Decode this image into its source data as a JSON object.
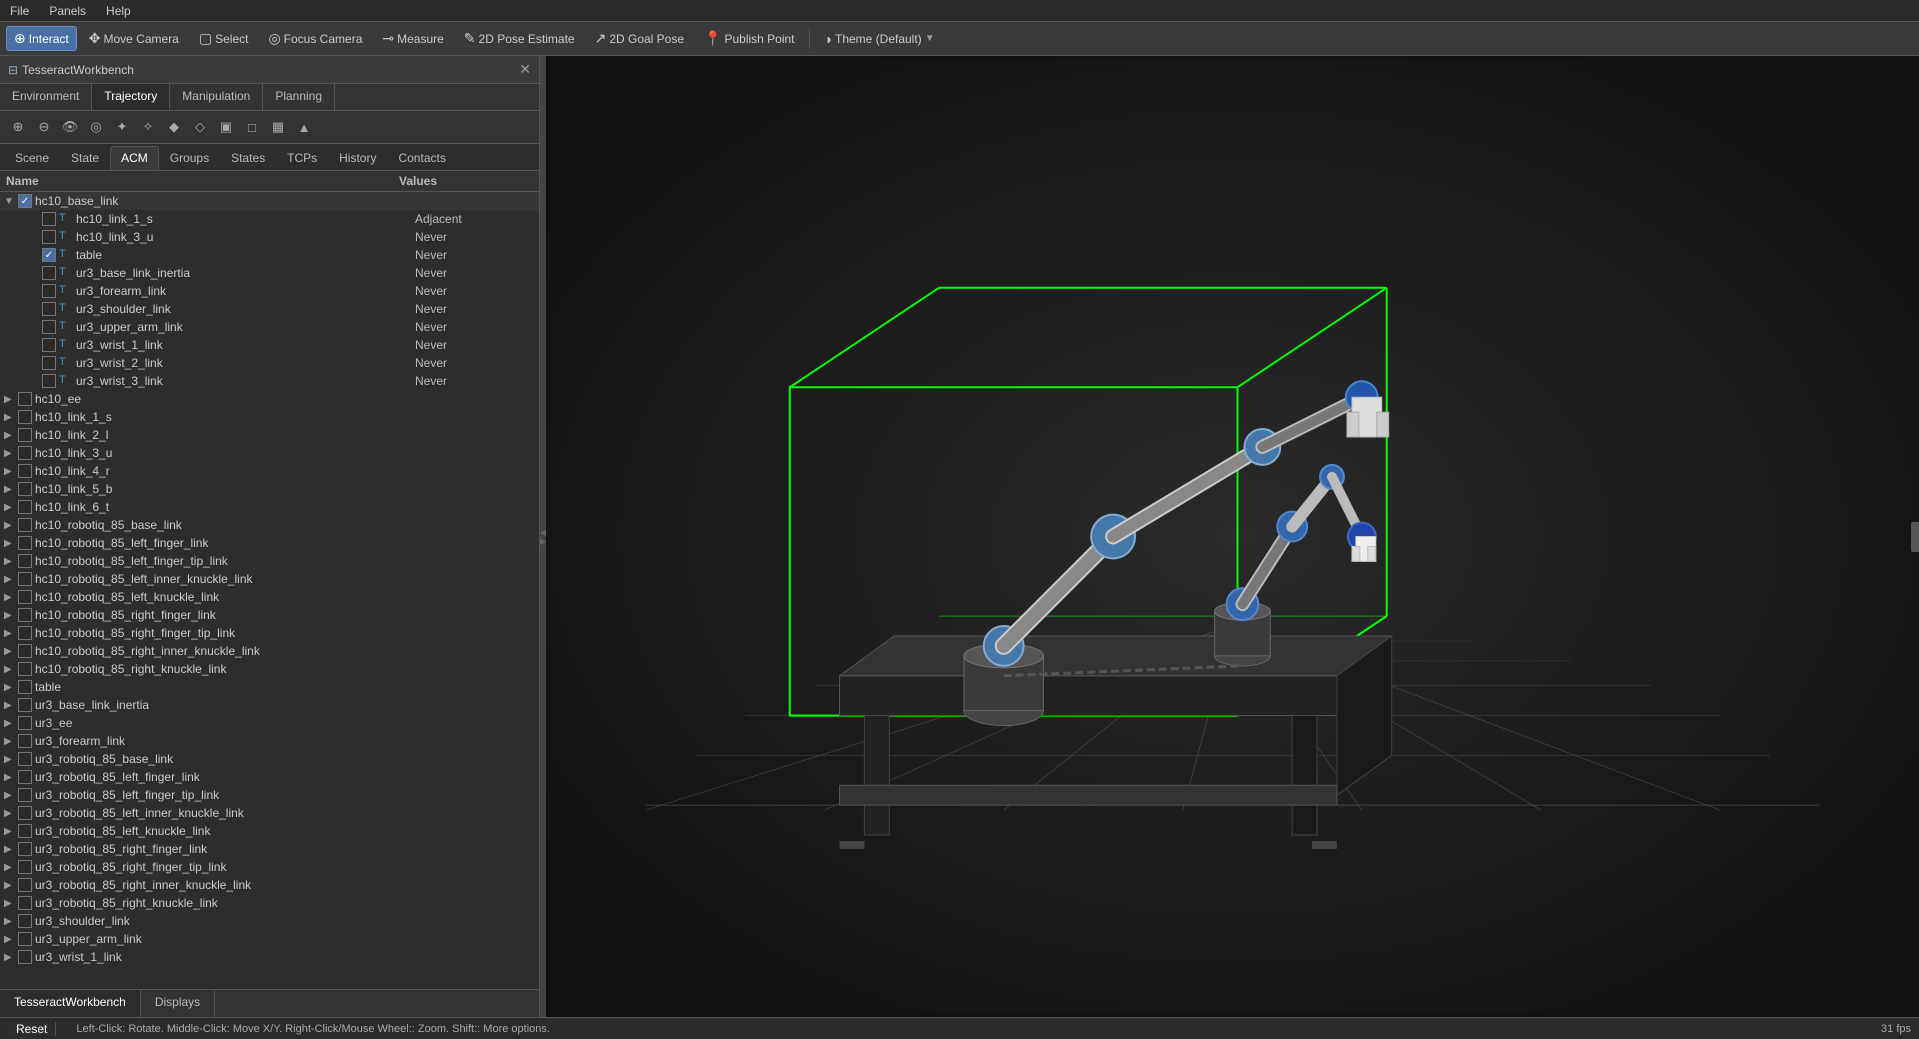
{
  "menubar": {
    "items": [
      "File",
      "Panels",
      "Help"
    ]
  },
  "toolbar": {
    "buttons": [
      {
        "id": "interact",
        "label": "Interact",
        "icon": "⊕",
        "active": true
      },
      {
        "id": "move-camera",
        "label": "Move Camera",
        "icon": "✥"
      },
      {
        "id": "select",
        "label": "Select",
        "icon": "▢"
      },
      {
        "id": "focus-camera",
        "label": "Focus Camera",
        "icon": "◎"
      },
      {
        "id": "measure",
        "label": "Measure",
        "icon": "⊸"
      },
      {
        "id": "2d-pose",
        "label": "2D Pose Estimate",
        "icon": "✎"
      },
      {
        "id": "2d-goal",
        "label": "2D Goal Pose",
        "icon": "↗"
      },
      {
        "id": "publish-point",
        "label": "Publish Point",
        "icon": "📍"
      },
      {
        "id": "theme",
        "label": "Theme (Default)",
        "icon": "◑"
      }
    ]
  },
  "panel": {
    "title": "TesseractWorkbench",
    "tabs_main": [
      {
        "id": "environment",
        "label": "Environment",
        "active": false
      },
      {
        "id": "trajectory",
        "label": "Trajectory",
        "active": true
      },
      {
        "id": "manipulation",
        "label": "Manipulation",
        "active": false
      },
      {
        "id": "planning",
        "label": "Planning",
        "active": false
      }
    ],
    "icon_toolbar": [
      "⊕",
      "⊕",
      "◎",
      "◎",
      "✦",
      "✦",
      "◆",
      "◆",
      "◇",
      "◇",
      "▣",
      "▲"
    ],
    "tabs_acm": [
      {
        "id": "scene",
        "label": "Scene"
      },
      {
        "id": "state",
        "label": "State"
      },
      {
        "id": "acm",
        "label": "ACM",
        "active": true
      },
      {
        "id": "groups",
        "label": "Groups"
      },
      {
        "id": "states",
        "label": "States"
      },
      {
        "id": "tcps",
        "label": "TCPs"
      },
      {
        "id": "history",
        "label": "History"
      },
      {
        "id": "contacts",
        "label": "Contacts"
      }
    ],
    "table": {
      "col_name": "Name",
      "col_value": "Values"
    }
  },
  "tree": {
    "rows": [
      {
        "id": "hc10_base_link",
        "label": "hc10_base_link",
        "level": 0,
        "expanded": true,
        "checked": true,
        "has_children": true,
        "value": ""
      },
      {
        "id": "hc10_link_1_s",
        "label": "hc10_link_1_s",
        "level": 2,
        "expanded": false,
        "checked": false,
        "has_children": false,
        "value": "Adjacent",
        "icon": "T"
      },
      {
        "id": "hc10_link_3_u",
        "label": "hc10_link_3_u",
        "level": 2,
        "expanded": false,
        "checked": false,
        "has_children": false,
        "value": "Never",
        "icon": "T"
      },
      {
        "id": "table",
        "label": "table",
        "level": 2,
        "expanded": false,
        "checked": true,
        "has_children": false,
        "value": "Never",
        "icon": "T"
      },
      {
        "id": "ur3_base_link_inertia",
        "label": "ur3_base_link_inertia",
        "level": 2,
        "expanded": false,
        "checked": false,
        "has_children": false,
        "value": "Never",
        "icon": "T"
      },
      {
        "id": "ur3_forearm_link",
        "label": "ur3_forearm_link",
        "level": 2,
        "expanded": false,
        "checked": false,
        "has_children": false,
        "value": "Never",
        "icon": "T"
      },
      {
        "id": "ur3_shoulder_link",
        "label": "ur3_shoulder_link",
        "level": 2,
        "expanded": false,
        "checked": false,
        "has_children": false,
        "value": "Never",
        "icon": "T"
      },
      {
        "id": "ur3_upper_arm_link",
        "label": "ur3_upper_arm_link",
        "level": 2,
        "expanded": false,
        "checked": false,
        "has_children": false,
        "value": "Never",
        "icon": "T"
      },
      {
        "id": "ur3_wrist_1_link",
        "label": "ur3_wrist_1_link",
        "level": 2,
        "expanded": false,
        "checked": false,
        "has_children": false,
        "value": "Never",
        "icon": "T"
      },
      {
        "id": "ur3_wrist_2_link",
        "label": "ur3_wrist_2_link",
        "level": 2,
        "expanded": false,
        "checked": false,
        "has_children": false,
        "value": "Never",
        "icon": "T"
      },
      {
        "id": "ur3_wrist_3_link",
        "label": "ur3_wrist_3_link",
        "level": 2,
        "expanded": false,
        "checked": false,
        "has_children": false,
        "value": "Never",
        "icon": "T"
      },
      {
        "id": "hc10_ee",
        "label": "hc10_ee",
        "level": 0,
        "expanded": false,
        "checked": false,
        "has_children": true,
        "value": ""
      },
      {
        "id": "hc10_link_1_s_2",
        "label": "hc10_link_1_s",
        "level": 0,
        "expanded": false,
        "checked": false,
        "has_children": true,
        "value": ""
      },
      {
        "id": "hc10_link_2_l",
        "label": "hc10_link_2_l",
        "level": 0,
        "expanded": false,
        "checked": false,
        "has_children": true,
        "value": ""
      },
      {
        "id": "hc10_link_3_u_2",
        "label": "hc10_link_3_u",
        "level": 0,
        "expanded": false,
        "checked": false,
        "has_children": true,
        "value": ""
      },
      {
        "id": "hc10_link_4_r",
        "label": "hc10_link_4_r",
        "level": 0,
        "expanded": false,
        "checked": false,
        "has_children": true,
        "value": ""
      },
      {
        "id": "hc10_link_5_b",
        "label": "hc10_link_5_b",
        "level": 0,
        "expanded": false,
        "checked": false,
        "has_children": true,
        "value": ""
      },
      {
        "id": "hc10_link_6_t",
        "label": "hc10_link_6_t",
        "level": 0,
        "expanded": false,
        "checked": false,
        "has_children": true,
        "value": ""
      },
      {
        "id": "hc10_robotiq_85_base_link",
        "label": "hc10_robotiq_85_base_link",
        "level": 0,
        "expanded": false,
        "checked": false,
        "has_children": true,
        "value": ""
      },
      {
        "id": "hc10_robotiq_85_left_finger_link",
        "label": "hc10_robotiq_85_left_finger_link",
        "level": 0,
        "expanded": false,
        "checked": false,
        "has_children": true,
        "value": ""
      },
      {
        "id": "hc10_robotiq_85_left_finger_tip_link",
        "label": "hc10_robotiq_85_left_finger_tip_link",
        "level": 0,
        "expanded": false,
        "checked": false,
        "has_children": true,
        "value": ""
      },
      {
        "id": "hc10_robotiq_85_left_inner_knuckle_link",
        "label": "hc10_robotiq_85_left_inner_knuckle_link",
        "level": 0,
        "expanded": false,
        "checked": false,
        "has_children": true,
        "value": ""
      },
      {
        "id": "hc10_robotiq_85_left_knuckle_link",
        "label": "hc10_robotiq_85_left_knuckle_link",
        "level": 0,
        "expanded": false,
        "checked": false,
        "has_children": true,
        "value": ""
      },
      {
        "id": "hc10_robotiq_85_right_finger_link",
        "label": "hc10_robotiq_85_right_finger_link",
        "level": 0,
        "expanded": false,
        "checked": false,
        "has_children": true,
        "value": ""
      },
      {
        "id": "hc10_robotiq_85_right_finger_tip_link",
        "label": "hc10_robotiq_85_right_finger_tip_link",
        "level": 0,
        "expanded": false,
        "checked": false,
        "has_children": true,
        "value": ""
      },
      {
        "id": "hc10_robotiq_85_right_inner_knuckle_link",
        "label": "hc10_robotiq_85_right_inner_knuckle_link",
        "level": 0,
        "expanded": false,
        "checked": false,
        "has_children": true,
        "value": ""
      },
      {
        "id": "hc10_robotiq_85_right_knuckle_link",
        "label": "hc10_robotiq_85_right_knuckle_link",
        "level": 0,
        "expanded": false,
        "checked": false,
        "has_children": true,
        "value": ""
      },
      {
        "id": "table_2",
        "label": "table",
        "level": 0,
        "expanded": false,
        "checked": false,
        "has_children": true,
        "value": ""
      },
      {
        "id": "ur3_base_link_inertia_2",
        "label": "ur3_base_link_inertia",
        "level": 0,
        "expanded": false,
        "checked": false,
        "has_children": true,
        "value": ""
      },
      {
        "id": "ur3_ee",
        "label": "ur3_ee",
        "level": 0,
        "expanded": false,
        "checked": false,
        "has_children": true,
        "value": ""
      },
      {
        "id": "ur3_forearm_link_2",
        "label": "ur3_forearm_link",
        "level": 0,
        "expanded": false,
        "checked": false,
        "has_children": true,
        "value": ""
      },
      {
        "id": "ur3_robotiq_85_base_link",
        "label": "ur3_robotiq_85_base_link",
        "level": 0,
        "expanded": false,
        "checked": false,
        "has_children": true,
        "value": ""
      },
      {
        "id": "ur3_robotiq_85_left_finger_link",
        "label": "ur3_robotiq_85_left_finger_link",
        "level": 0,
        "expanded": false,
        "checked": false,
        "has_children": true,
        "value": ""
      },
      {
        "id": "ur3_robotiq_85_left_finger_tip_link",
        "label": "ur3_robotiq_85_left_finger_tip_link",
        "level": 0,
        "expanded": false,
        "checked": false,
        "has_children": true,
        "value": ""
      },
      {
        "id": "ur3_robotiq_85_left_inner_knuckle_link",
        "label": "ur3_robotiq_85_left_inner_knuckle_link",
        "level": 0,
        "expanded": false,
        "checked": false,
        "has_children": true,
        "value": ""
      },
      {
        "id": "ur3_robotiq_85_left_knuckle_link",
        "label": "ur3_robotiq_85_left_knuckle_link",
        "level": 0,
        "expanded": false,
        "checked": false,
        "has_children": true,
        "value": ""
      },
      {
        "id": "ur3_robotiq_85_right_finger_link",
        "label": "ur3_robotiq_85_right_finger_link",
        "level": 0,
        "expanded": false,
        "checked": false,
        "has_children": true,
        "value": ""
      },
      {
        "id": "ur3_robotiq_85_right_finger_tip_link",
        "label": "ur3_robotiq_85_right_finger_tip_link",
        "level": 0,
        "expanded": false,
        "checked": false,
        "has_children": true,
        "value": ""
      },
      {
        "id": "ur3_robotiq_85_right_inner_knuckle_link",
        "label": "ur3_robotiq_85_right_inner_knuckle_link",
        "level": 0,
        "expanded": false,
        "checked": false,
        "has_children": true,
        "value": ""
      },
      {
        "id": "ur3_robotiq_85_right_knuckle_link",
        "label": "ur3_robotiq_85_right_knuckle_link",
        "level": 0,
        "expanded": false,
        "checked": false,
        "has_children": true,
        "value": ""
      },
      {
        "id": "ur3_shoulder_link_2",
        "label": "ur3_shoulder_link",
        "level": 0,
        "expanded": false,
        "checked": false,
        "has_children": true,
        "value": ""
      },
      {
        "id": "ur3_upper_arm_link_2",
        "label": "ur3_upper_arm_link",
        "level": 0,
        "expanded": false,
        "checked": false,
        "has_children": true,
        "value": ""
      },
      {
        "id": "ur3_wrist_1_link_2",
        "label": "ur3_wrist_1_link",
        "level": 0,
        "expanded": false,
        "checked": false,
        "has_children": true,
        "value": ""
      }
    ]
  },
  "bottom_tabs": [
    {
      "id": "tesseract-workbench",
      "label": "TesseractWorkbench",
      "active": true
    },
    {
      "id": "displays",
      "label": "Displays",
      "active": false
    }
  ],
  "status_bar": {
    "reset": "Reset",
    "hint": "Left-Click: Rotate.  Middle-Click: Move X/Y.  Right-Click/Mouse Wheel:: Zoom.  Shift:: More options.",
    "fps": "31 fps"
  }
}
